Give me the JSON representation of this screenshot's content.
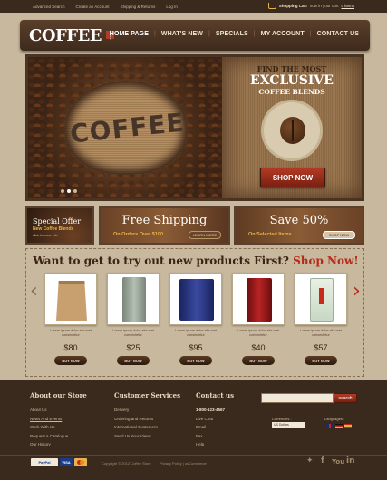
{
  "topbar": {
    "links": [
      "Advanced Search",
      "Create an Account",
      "Shipping & Returns",
      "Log In"
    ],
    "cart_label": "Shopping Cart",
    "cart_text": "now in your cart",
    "cart_items": "0 items"
  },
  "header": {
    "logo": "COFFEE",
    "logo_tag": "STORE",
    "nav": [
      "HOME PAGE",
      "WHAT'S NEW",
      "SPECIALS",
      "MY ACCOUNT",
      "CONTACT US"
    ]
  },
  "hero": {
    "word": "COFFEE",
    "line1": "FIND THE MOST",
    "line2": "EXCLUSIVE",
    "line3": "COFFEE BLENDS",
    "button": "SHOP NOW"
  },
  "promos": [
    {
      "title": "Special Offer",
      "subtitle": "New Coffee Blends",
      "note": "click for more info"
    },
    {
      "title": "Free Shipping",
      "subtitle": "On Orders Over $100",
      "button": "LEARN MORE"
    },
    {
      "title": "Save 50%",
      "subtitle": "On Selected Items",
      "button": "SHOP NOW"
    }
  ],
  "products_section": {
    "heading": "Want to get to try out new products First?",
    "heading_accent": "Shop Now!",
    "items": [
      {
        "desc": "Lorem ipsum dolor sita met consectetur",
        "price": "$80",
        "button": "BUY NOW",
        "color": "#c8a070"
      },
      {
        "desc": "Lorem ipsum dolor sita met consectetur",
        "price": "$25",
        "button": "BUY NOW",
        "color": "#9aa59a"
      },
      {
        "desc": "Lorem ipsum dolor sita met consectetur",
        "price": "$95",
        "button": "BUY NOW",
        "color": "#2a3a8a"
      },
      {
        "desc": "Lorem ipsum dolor sita met consectetur",
        "price": "$40",
        "button": "BUY NOW",
        "color": "#9a1a1a"
      },
      {
        "desc": "Lorem ipsum dolor sita met consectetur",
        "price": "$57",
        "button": "BUY NOW",
        "color": "#d4e0d0"
      }
    ]
  },
  "footer": {
    "col1": {
      "title": "About our Store",
      "items": [
        "About Us",
        "News And Events",
        "Work With Us",
        "Request A Catalogue",
        "Our History"
      ]
    },
    "col2": {
      "title": "Customer Services",
      "items": [
        "Delivery",
        "Ordering and Returns",
        "International Customers",
        "Send Us Your Views"
      ]
    },
    "col3": {
      "title": "Contact us",
      "items": [
        "1-800-123-4567",
        "Live Chat",
        "Email",
        "Fax",
        "Help"
      ]
    },
    "search_button": "search",
    "currencies_label": "Currencies :",
    "currency_value": "US Dollars",
    "languages_label": "Languages :",
    "payment": [
      "PayPal",
      "VISA"
    ],
    "copyright": "Copyright © 2012 Coffee Store",
    "privacy": "Privacy Policy",
    "oscommerce": "osCommerce"
  },
  "colors": {
    "accent": "#b52a1a",
    "dark": "#3a2a1e",
    "gold": "#e9b34a"
  }
}
